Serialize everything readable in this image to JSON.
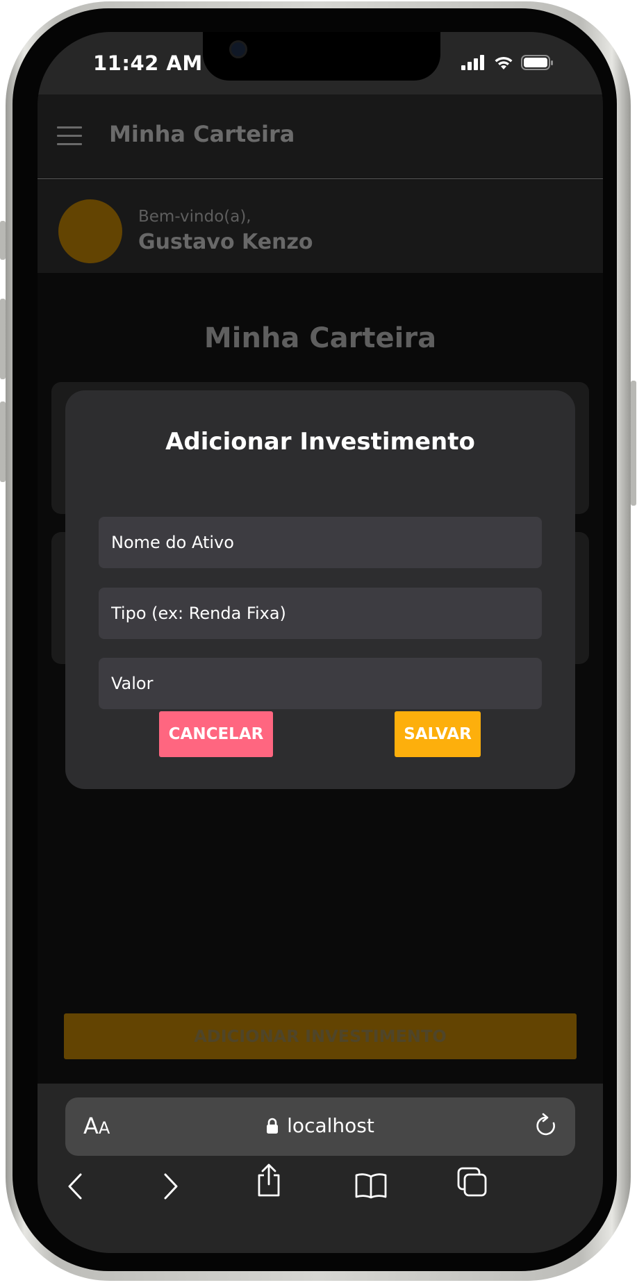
{
  "status_bar": {
    "time": "11:42 AM"
  },
  "app_header": {
    "title": "Minha Carteira"
  },
  "user": {
    "greeting": "Bem-vindo(a),",
    "name": "Gustavo Kenzo"
  },
  "page": {
    "title": "Minha Carteira",
    "add_button_label": "ADICIONAR INVESTIMENTO"
  },
  "modal": {
    "title": "Adicionar Investimento",
    "fields": [
      {
        "placeholder": "Nome do Ativo",
        "value": ""
      },
      {
        "placeholder": "Tipo (ex: Renda Fixa)",
        "value": ""
      },
      {
        "placeholder": "Valor",
        "value": ""
      }
    ],
    "cancel_label": "CANCELAR",
    "save_label": "SALVAR"
  },
  "browser": {
    "text_size_label_big": "A",
    "text_size_label_small": "A",
    "url": "localhost"
  },
  "colors": {
    "accent": "#fdaf0c",
    "cancel": "#ff6680",
    "avatar": "#634402",
    "modal_bg": "#2d2d2f"
  },
  "icons": [
    "menu-icon",
    "lock-icon",
    "reload-icon",
    "back-icon",
    "forward-icon",
    "share-icon",
    "bookmarks-icon",
    "tabs-icon",
    "signal-icon",
    "wifi-icon",
    "battery-icon"
  ]
}
